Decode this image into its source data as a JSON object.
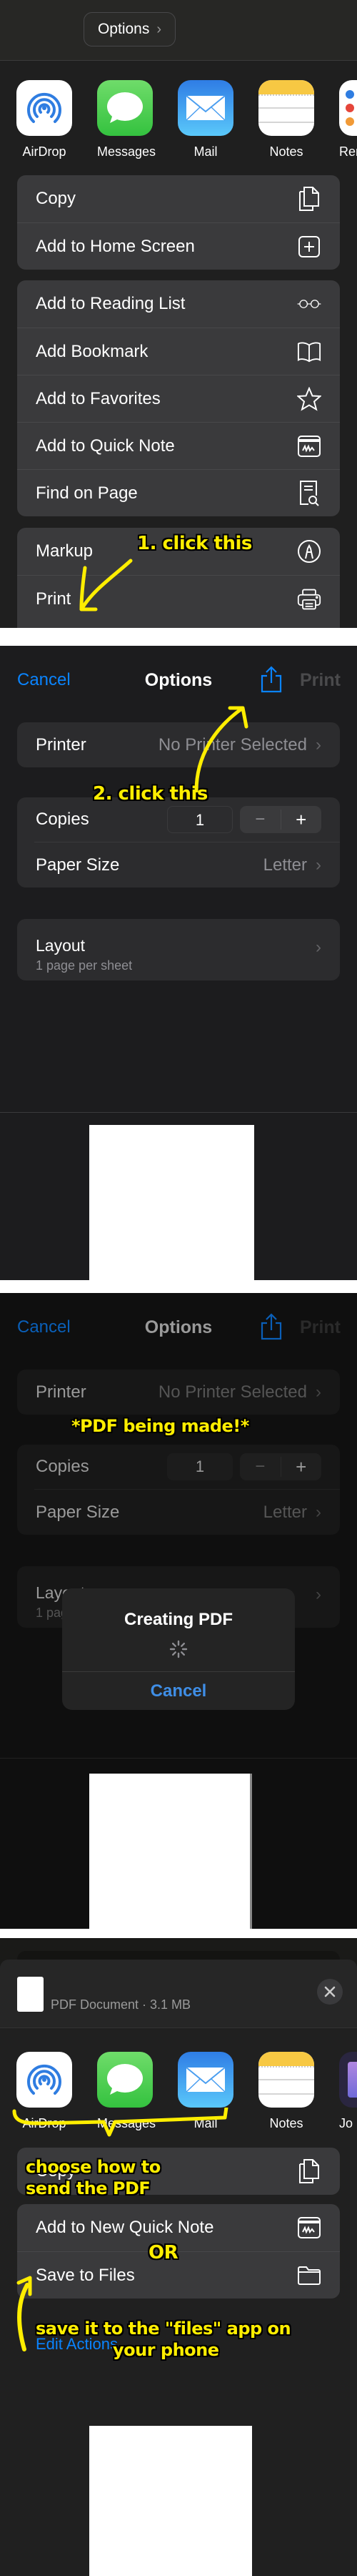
{
  "panel1": {
    "options_label": "Options",
    "apps": [
      {
        "name": "AirDrop",
        "icon": "airdrop-icon"
      },
      {
        "name": "Messages",
        "icon": "messages-icon"
      },
      {
        "name": "Mail",
        "icon": "mail-icon"
      },
      {
        "name": "Notes",
        "icon": "notes-icon"
      },
      {
        "name": "Rem",
        "icon": "reminders-icon"
      }
    ],
    "group1": [
      {
        "label": "Copy",
        "icon": "copy-icon"
      },
      {
        "label": "Add to Home Screen",
        "icon": "add-square-icon"
      }
    ],
    "group2": [
      {
        "label": "Add to Reading List",
        "icon": "glasses-icon"
      },
      {
        "label": "Add Bookmark",
        "icon": "book-icon"
      },
      {
        "label": "Add to Favorites",
        "icon": "star-icon"
      },
      {
        "label": "Add to Quick Note",
        "icon": "quick-note-icon"
      },
      {
        "label": "Find on Page",
        "icon": "find-on-page-icon"
      }
    ],
    "group3": [
      {
        "label": "Markup",
        "icon": "markup-icon"
      },
      {
        "label": "Print",
        "icon": "printer-icon"
      }
    ],
    "annotation": "1. click this"
  },
  "print_options": {
    "cancel": "Cancel",
    "title": "Options",
    "print": "Print",
    "printer_label": "Printer",
    "printer_value": "No Printer Selected",
    "copies_label": "Copies",
    "copies_value": "1",
    "minus": "−",
    "plus": "+",
    "paper_size_label": "Paper Size",
    "paper_size_value": "Letter",
    "layout_label": "Layout",
    "layout_value": "1 page per sheet"
  },
  "panel2": {
    "annotation": "2. click this"
  },
  "panel3": {
    "annotation": "*PDF being made!*",
    "alert_title": "Creating PDF",
    "alert_cancel": "Cancel"
  },
  "panel4": {
    "doc_info": "PDF Document · 3.1 MB",
    "apps": [
      {
        "name": "AirDrop"
      },
      {
        "name": "Messages"
      },
      {
        "name": "Mail"
      },
      {
        "name": "Notes"
      },
      {
        "name": "Jo"
      }
    ],
    "group1": [
      {
        "label": "Copy",
        "icon": "copy-icon"
      }
    ],
    "group2": [
      {
        "label": "Add to New Quick Note",
        "icon": "quick-note-icon"
      },
      {
        "label": "Save to Files",
        "icon": "folder-icon"
      }
    ],
    "edit_actions": "Edit Actions...",
    "annotation_choose": "choose how to\nsend the PDF",
    "annotation_or": "OR",
    "annotation_save_line1": "save it to the \"files\" app on",
    "annotation_save_line2": "your phone"
  },
  "colors": {
    "accent": "#0a84ff",
    "highlight": "#ffee00"
  }
}
